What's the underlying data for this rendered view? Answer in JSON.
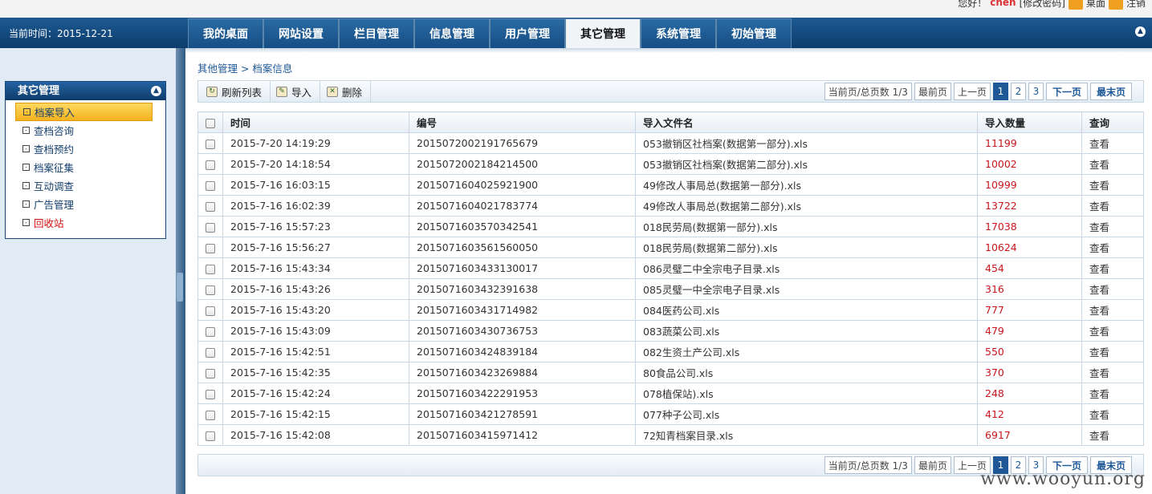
{
  "top": {
    "greeting": "您好！",
    "user": "chen",
    "links": "[修改密码]",
    "desktop": "桌面",
    "logout": "注销"
  },
  "header": {
    "time_label": "当前时间：",
    "time_value": "2015-12-21",
    "tabs": [
      "我的桌面",
      "网站设置",
      "栏目管理",
      "信息管理",
      "用户管理",
      "其它管理",
      "系统管理",
      "初始管理"
    ],
    "active_tab": "其它管理"
  },
  "sidebar": {
    "title": "其它管理",
    "items": [
      "档案导入",
      "查档咨询",
      "查档预约",
      "档案征集",
      "互动调查",
      "广告管理",
      "回收站"
    ]
  },
  "breadcrumb": "其他管理 > 档案信息",
  "toolbar": {
    "refresh": "刷新列表",
    "import": "导入",
    "delete": "删除"
  },
  "pager": {
    "info": "当前页/总页数 1/3",
    "first": "最前页",
    "prev": "上一页",
    "pages": [
      "1",
      "2",
      "3"
    ],
    "next": "下一页",
    "last": "最末页"
  },
  "table": {
    "headers": [
      "时间",
      "编号",
      "导入文件名",
      "导入数量",
      "查询"
    ],
    "rows": [
      [
        "2015-7-20 14:19:29",
        "2015072002191765679",
        "053撤销区社档案(数据第一部分).xls",
        "11199",
        "查看"
      ],
      [
        "2015-7-20 14:18:54",
        "2015072002184214500",
        "053撤销区社档案(数据第二部分).xls",
        "10002",
        "查看"
      ],
      [
        "2015-7-16 16:03:15",
        "2015071604025921900",
        "49修改人事局总(数据第一部分).xls",
        "10999",
        "查看"
      ],
      [
        "2015-7-16 16:02:39",
        "2015071604021783774",
        "49修改人事局总(数据第二部分).xls",
        "13722",
        "查看"
      ],
      [
        "2015-7-16 15:57:23",
        "2015071603570342541",
        "018民劳局(数据第一部分).xls",
        "17038",
        "查看"
      ],
      [
        "2015-7-16 15:56:27",
        "2015071603561560050",
        "018民劳局(数据第二部分).xls",
        "10624",
        "查看"
      ],
      [
        "2015-7-16 15:43:34",
        "2015071603433130017",
        "086灵璧二中全宗电子目录.xls",
        "454",
        "查看"
      ],
      [
        "2015-7-16 15:43:26",
        "2015071603432391638",
        "085灵璧一中全宗电子目录.xls",
        "316",
        "查看"
      ],
      [
        "2015-7-16 15:43:20",
        "2015071603431714982",
        "084医药公司.xls",
        "777",
        "查看"
      ],
      [
        "2015-7-16 15:43:09",
        "2015071603430736753",
        "083蔬菜公司.xls",
        "479",
        "查看"
      ],
      [
        "2015-7-16 15:42:51",
        "2015071603424839184",
        "082生资土产公司.xls",
        "550",
        "查看"
      ],
      [
        "2015-7-16 15:42:35",
        "2015071603423269884",
        "80食品公司.xls",
        "370",
        "查看"
      ],
      [
        "2015-7-16 15:42:24",
        "2015071603422291953",
        "078植保站).xls",
        "248",
        "查看"
      ],
      [
        "2015-7-16 15:42:15",
        "2015071603421278591",
        "077种子公司.xls",
        "412",
        "查看"
      ],
      [
        "2015-7-16 15:42:08",
        "2015071603415971412",
        "72知青档案目录.xls",
        "6917",
        "查看"
      ]
    ]
  },
  "watermark": "www.wooyun.org"
}
